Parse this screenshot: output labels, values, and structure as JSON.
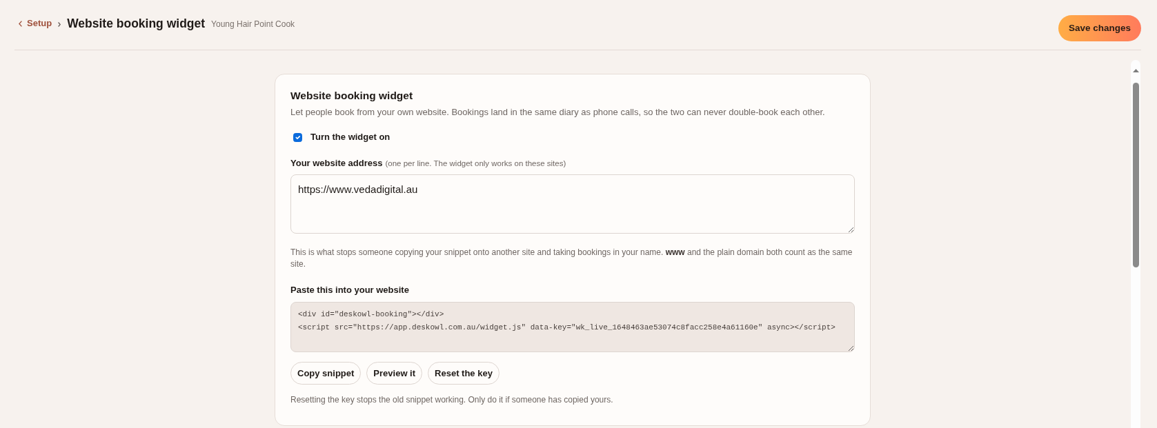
{
  "header": {
    "back_link": "Setup",
    "title": "Website booking widget",
    "subtitle": "Young Hair Point Cook",
    "save_button": "Save changes"
  },
  "card": {
    "title": "Website booking widget",
    "description": "Let people book from your own website. Bookings land in the same diary as phone calls, so the two can never double-book each other.",
    "toggle": {
      "label": "Turn the widget on",
      "checked": true
    },
    "address_field": {
      "label": "Your website address",
      "hint": "(one per line. The widget only works on these sites)",
      "value": "https://www.vedadigital.au",
      "help": "This is what stops someone copying your snippet onto another site and taking bookings in your name. **www** and the plain domain both count as the same site."
    },
    "snippet_field": {
      "label": "Paste this into your website",
      "value": "<div id=\"deskowl-booking\"></div>\n<script src=\"https://app.deskowl.com.au/widget.js\" data-key=\"wk_live_1648463ae53074c8facc258e4a61160e\" async></script>"
    },
    "buttons": [
      "Copy snippet",
      "Preview it",
      "Reset the key"
    ],
    "note": "Resetting the key stops the old snippet working. Only do it if someone has copied yours."
  }
}
